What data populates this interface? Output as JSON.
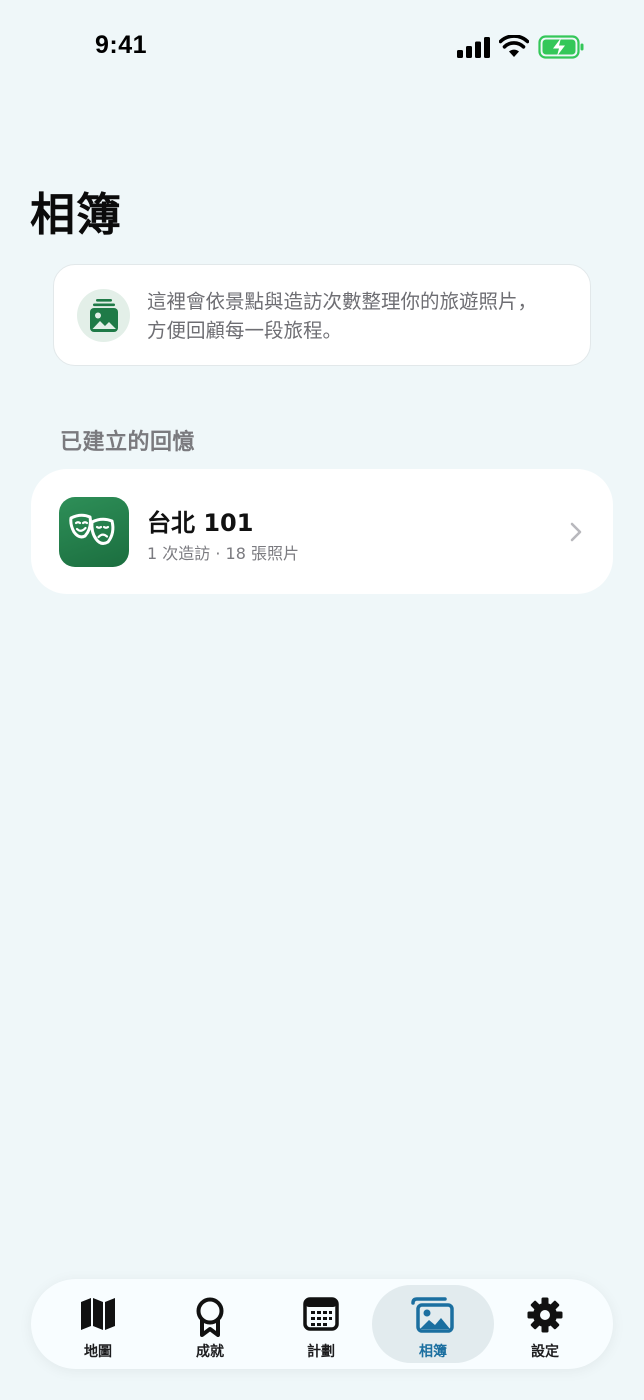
{
  "status_bar": {
    "time": "9:41"
  },
  "page": {
    "title": "相簿"
  },
  "info_card": {
    "icon": "photo-stack-icon",
    "text": "這裡會依景點與造訪次數整理你的旅遊照片，方便回顧每一段旅程。"
  },
  "section": {
    "label": "已建立的回憶"
  },
  "memories": [
    {
      "title": "台北 101",
      "subtitle": "1 次造訪 · 18 張照片",
      "icon": "theater-masks-icon"
    }
  ],
  "tab_bar": {
    "tabs": [
      {
        "label": "地圖",
        "icon": "map-icon"
      },
      {
        "label": "成就",
        "icon": "award-icon"
      },
      {
        "label": "計劃",
        "icon": "calendar-icon"
      },
      {
        "label": "相簿",
        "icon": "photo-album-icon",
        "active": true
      },
      {
        "label": "設定",
        "icon": "gear-icon"
      }
    ]
  },
  "colors": {
    "background": "#eff7f9",
    "accent_green": "#2e8f58",
    "active_tab": "#1b6fa0",
    "battery_green": "#34c759"
  }
}
